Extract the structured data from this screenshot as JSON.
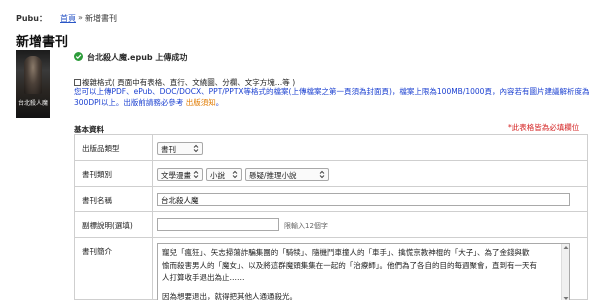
{
  "header": {
    "brand": "Pubu：",
    "breadcrumb_home": "首頁",
    "breadcrumb_sep": "»",
    "breadcrumb_current": "新增書刊"
  },
  "page_title": "新增書刊",
  "cover": {
    "text": "台北殺人魔"
  },
  "upload": {
    "status_text": "台北殺人魔.epub 上傳成功",
    "status_color": "#2d9c3a"
  },
  "format_line": "複雜格式( 頁面中有表格、直行、文繞圖、分欄、文字方塊…等 )",
  "notice": {
    "text": "您可以上傳PDF、ePub、DOC/DOCX、PPT/PPTX等格式的檔案(上傳檔案之第一頁須為封面頁)，檔案上限為100MB/1000頁，內容若有圖片建議解析度為300DPI以上。出版前請務必參考 ",
    "link": "出版須知",
    "end": "。",
    "text_color": "#1a3fd0",
    "link_color": "#e07a00"
  },
  "section": {
    "title": "基本資料",
    "required_note": "*此表格皆為必填欄位"
  },
  "form": {
    "pub_type": {
      "label": "出版品類型",
      "value": "書刊"
    },
    "category": {
      "label": "書刊類別",
      "level1": "文學漫畫",
      "level2": "小說",
      "level3": "懸疑/推理小說"
    },
    "title": {
      "label": "書刊名稱",
      "value": "台北殺人魔"
    },
    "subtitle": {
      "label": "副標說明(選填)",
      "value": "",
      "hint": "限輸入12個字"
    },
    "summary": {
      "label": "書刊簡介",
      "line1": "寵兒「瘋狂」、矢志掃蕩詐騙集團的「騎犊」、隨機鬥車撞人的「車手」、擒慌京教神棍的「大子」、為了金錢與歡",
      "line2": "愉而殺害男人的「魔女」、以及將這群魔頭集集在一起的「治療師」。他們為了各自的目的每週聚會，直到有一天有",
      "line3": "人打算收手退出為止……",
      "line4": "因為想要退出，就得把其他人通通殺光。"
    }
  }
}
